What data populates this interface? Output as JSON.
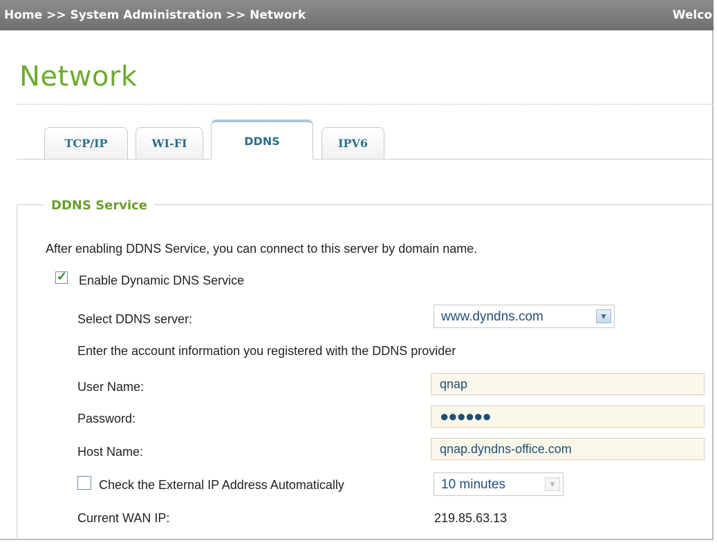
{
  "header": {
    "breadcrumb": "Home >> System Administration >> Network",
    "welcome": "Welco"
  },
  "page": {
    "title": "Network"
  },
  "tabs": [
    {
      "label": "TCP/IP",
      "active": false
    },
    {
      "label": "WI-FI",
      "active": false
    },
    {
      "label": "DDNS",
      "active": true
    },
    {
      "label": "IPV6",
      "active": false
    }
  ],
  "ddns": {
    "section_title": "DDNS Service",
    "description": "After enabling DDNS Service, you can connect to this server by domain name.",
    "enable": {
      "label": "Enable Dynamic DNS Service",
      "checked": true
    },
    "server": {
      "label": "Select DDNS server:",
      "value": "www.dyndns.com"
    },
    "account_info": "Enter the account information you registered with the DDNS provider",
    "username": {
      "label": "User Name:",
      "value": "qnap"
    },
    "password": {
      "label": "Password:",
      "value": "●●●●●●"
    },
    "hostname": {
      "label": "Host Name:",
      "value": "qnap.dyndns-office.com"
    },
    "auto_check": {
      "label": "Check the External IP Address Automatically",
      "checked": false,
      "interval": "10 minutes"
    },
    "wan_ip": {
      "label": "Current WAN IP:",
      "value": "219.85.63.13"
    }
  },
  "colors": {
    "accent_green": "#6cab2c",
    "tab_text": "#2a6f88",
    "header_bg": "#7d7d7d"
  },
  "icons": {
    "checkbox": "checkbox-icon",
    "dropdown": "chevron-down-icon"
  }
}
